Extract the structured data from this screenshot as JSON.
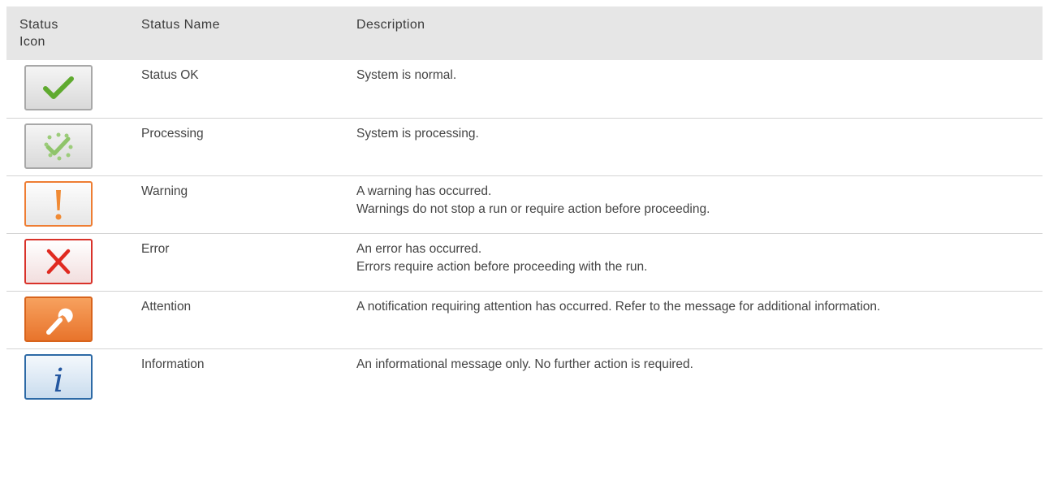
{
  "table": {
    "headers": {
      "icon": "Status Icon",
      "name": "Status Name",
      "description": "Description"
    },
    "rows": [
      {
        "icon": "checkmark-icon",
        "name": "Status OK",
        "description": [
          "System is normal."
        ]
      },
      {
        "icon": "processing-icon",
        "name": "Processing",
        "description": [
          "System is processing."
        ]
      },
      {
        "icon": "warning-icon",
        "name": "Warning",
        "description": [
          "A warning has occurred.",
          "Warnings do not stop a run or require action before proceeding."
        ]
      },
      {
        "icon": "error-icon",
        "name": "Error",
        "description": [
          "An error has occurred.",
          "Errors require action before proceeding with the run."
        ]
      },
      {
        "icon": "wrench-icon",
        "name": "Attention",
        "description": [
          "A notification requiring attention has occurred. Refer to the message for additional information."
        ]
      },
      {
        "icon": "info-icon",
        "name": "Information",
        "description": [
          "An informational message only. No further action is required."
        ]
      }
    ]
  },
  "colors": {
    "header_bg": "#e6e6e6",
    "ok_green": "#5faa2f",
    "warning_orange": "#ee7d33",
    "error_red": "#d9322a",
    "info_blue": "#2d6aa6"
  }
}
